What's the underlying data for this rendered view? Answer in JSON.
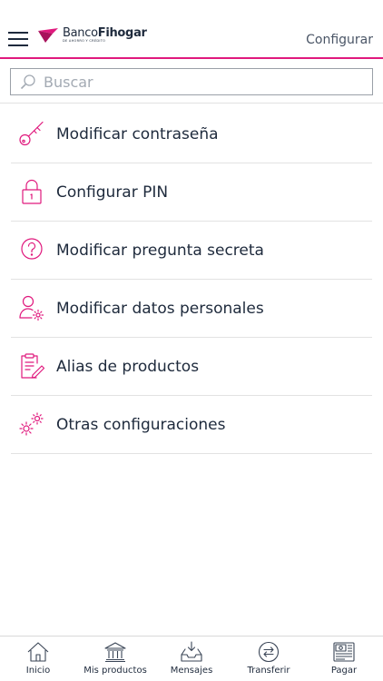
{
  "header": {
    "logo_text_regular": "Banco",
    "logo_text_bold": "Fihogar",
    "logo_tagline": "DE AHORRO Y CRÉDITO",
    "action_label": "Configurar"
  },
  "search": {
    "placeholder": "Buscar",
    "value": ""
  },
  "menu": {
    "items": [
      {
        "label": "Modificar contraseña",
        "icon": "key-icon"
      },
      {
        "label": "Configurar PIN",
        "icon": "lock-icon"
      },
      {
        "label": "Modificar pregunta secreta",
        "icon": "question-icon"
      },
      {
        "label": "Modificar datos personales",
        "icon": "user-settings-icon"
      },
      {
        "label": "Alias de productos",
        "icon": "clipboard-edit-icon"
      },
      {
        "label": "Otras configuraciones",
        "icon": "gears-icon"
      }
    ]
  },
  "bottom_nav": {
    "items": [
      {
        "label": "Inicio",
        "icon": "home-icon"
      },
      {
        "label": "Mis productos",
        "icon": "bank-icon"
      },
      {
        "label": "Mensajes",
        "icon": "inbox-icon"
      },
      {
        "label": "Transferir",
        "icon": "transfer-icon"
      },
      {
        "label": "Pagar",
        "icon": "payment-icon"
      }
    ]
  },
  "colors": {
    "accent": "#e0197d",
    "text": "#1e2a3c",
    "divider": "#e2e2e2"
  }
}
